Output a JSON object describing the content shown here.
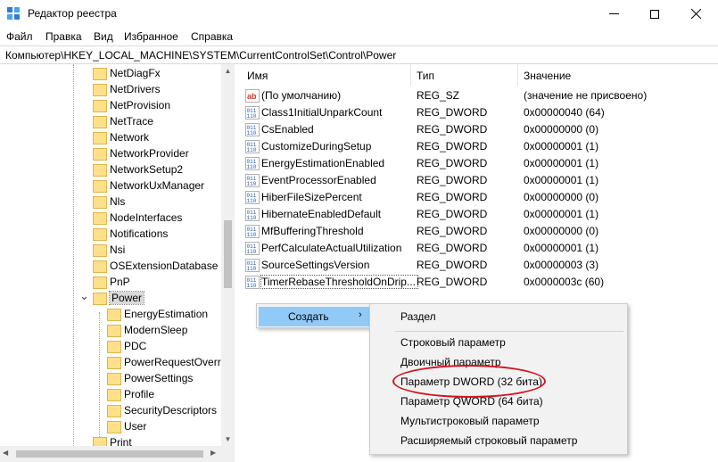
{
  "window": {
    "title": "Редактор реестра",
    "icon": "regedit-icon"
  },
  "menu": [
    "Файл",
    "Правка",
    "Вид",
    "Избранное",
    "Справка"
  ],
  "address": "Компьютер\\HKEY_LOCAL_MACHINE\\SYSTEM\\CurrentControlSet\\Control\\Power",
  "tree": {
    "items": [
      {
        "label": "NetDiagFx",
        "level": 1
      },
      {
        "label": "NetDrivers",
        "level": 1
      },
      {
        "label": "NetProvision",
        "level": 1
      },
      {
        "label": "NetTrace",
        "level": 1
      },
      {
        "label": "Network",
        "level": 1
      },
      {
        "label": "NetworkProvider",
        "level": 1
      },
      {
        "label": "NetworkSetup2",
        "level": 1
      },
      {
        "label": "NetworkUxManager",
        "level": 1
      },
      {
        "label": "Nls",
        "level": 1
      },
      {
        "label": "NodeInterfaces",
        "level": 1
      },
      {
        "label": "Notifications",
        "level": 1
      },
      {
        "label": "Nsi",
        "level": 1
      },
      {
        "label": "OSExtensionDatabase",
        "level": 1
      },
      {
        "label": "PnP",
        "level": 1
      },
      {
        "label": "Power",
        "level": 1,
        "expanded": true,
        "selected": true
      },
      {
        "label": "EnergyEstimation",
        "level": 2
      },
      {
        "label": "ModernSleep",
        "level": 2
      },
      {
        "label": "PDC",
        "level": 2
      },
      {
        "label": "PowerRequestOverri",
        "level": 2
      },
      {
        "label": "PowerSettings",
        "level": 2
      },
      {
        "label": "Profile",
        "level": 2
      },
      {
        "label": "SecurityDescriptors",
        "level": 2
      },
      {
        "label": "User",
        "level": 2
      },
      {
        "label": "Print",
        "level": 1
      }
    ]
  },
  "columns": {
    "name": "Имя",
    "type": "Тип",
    "value": "Значение"
  },
  "values": [
    {
      "name": "(По умолчанию)",
      "type": "REG_SZ",
      "data": "(значение не присвоено)",
      "icon": "string-value-icon"
    },
    {
      "name": "Class1InitialUnparkCount",
      "type": "REG_DWORD",
      "data": "0x00000040 (64)",
      "icon": "binary-value-icon"
    },
    {
      "name": "CsEnabled",
      "type": "REG_DWORD",
      "data": "0x00000000 (0)",
      "icon": "binary-value-icon"
    },
    {
      "name": "CustomizeDuringSetup",
      "type": "REG_DWORD",
      "data": "0x00000001 (1)",
      "icon": "binary-value-icon"
    },
    {
      "name": "EnergyEstimationEnabled",
      "type": "REG_DWORD",
      "data": "0x00000001 (1)",
      "icon": "binary-value-icon"
    },
    {
      "name": "EventProcessorEnabled",
      "type": "REG_DWORD",
      "data": "0x00000001 (1)",
      "icon": "binary-value-icon"
    },
    {
      "name": "HiberFileSizePercent",
      "type": "REG_DWORD",
      "data": "0x00000000 (0)",
      "icon": "binary-value-icon"
    },
    {
      "name": "HibernateEnabledDefault",
      "type": "REG_DWORD",
      "data": "0x00000001 (1)",
      "icon": "binary-value-icon"
    },
    {
      "name": "MfBufferingThreshold",
      "type": "REG_DWORD",
      "data": "0x00000000 (0)",
      "icon": "binary-value-icon"
    },
    {
      "name": "PerfCalculateActualUtilization",
      "type": "REG_DWORD",
      "data": "0x00000001 (1)",
      "icon": "binary-value-icon"
    },
    {
      "name": "SourceSettingsVersion",
      "type": "REG_DWORD",
      "data": "0x00000003 (3)",
      "icon": "binary-value-icon"
    },
    {
      "name": "TimerRebaseThresholdOnDrip...",
      "type": "REG_DWORD",
      "data": "0x0000003c (60)",
      "icon": "binary-value-icon"
    }
  ],
  "context_menu": {
    "create_label": "Создать",
    "submenu": {
      "key": "Раздел",
      "string": "Строковый параметр",
      "binary": "Двоичный параметр",
      "dword": "Параметр DWORD (32 бита)",
      "qword": "Параметр QWORD (64 бита)",
      "multi_string": "Мультистроковый параметр",
      "expand_string": "Расширяемый строковый параметр"
    }
  },
  "colors": {
    "highlight_ellipse": "#d0141e",
    "menu_hover": "#91c9f7",
    "folder": "#ffe08a"
  }
}
